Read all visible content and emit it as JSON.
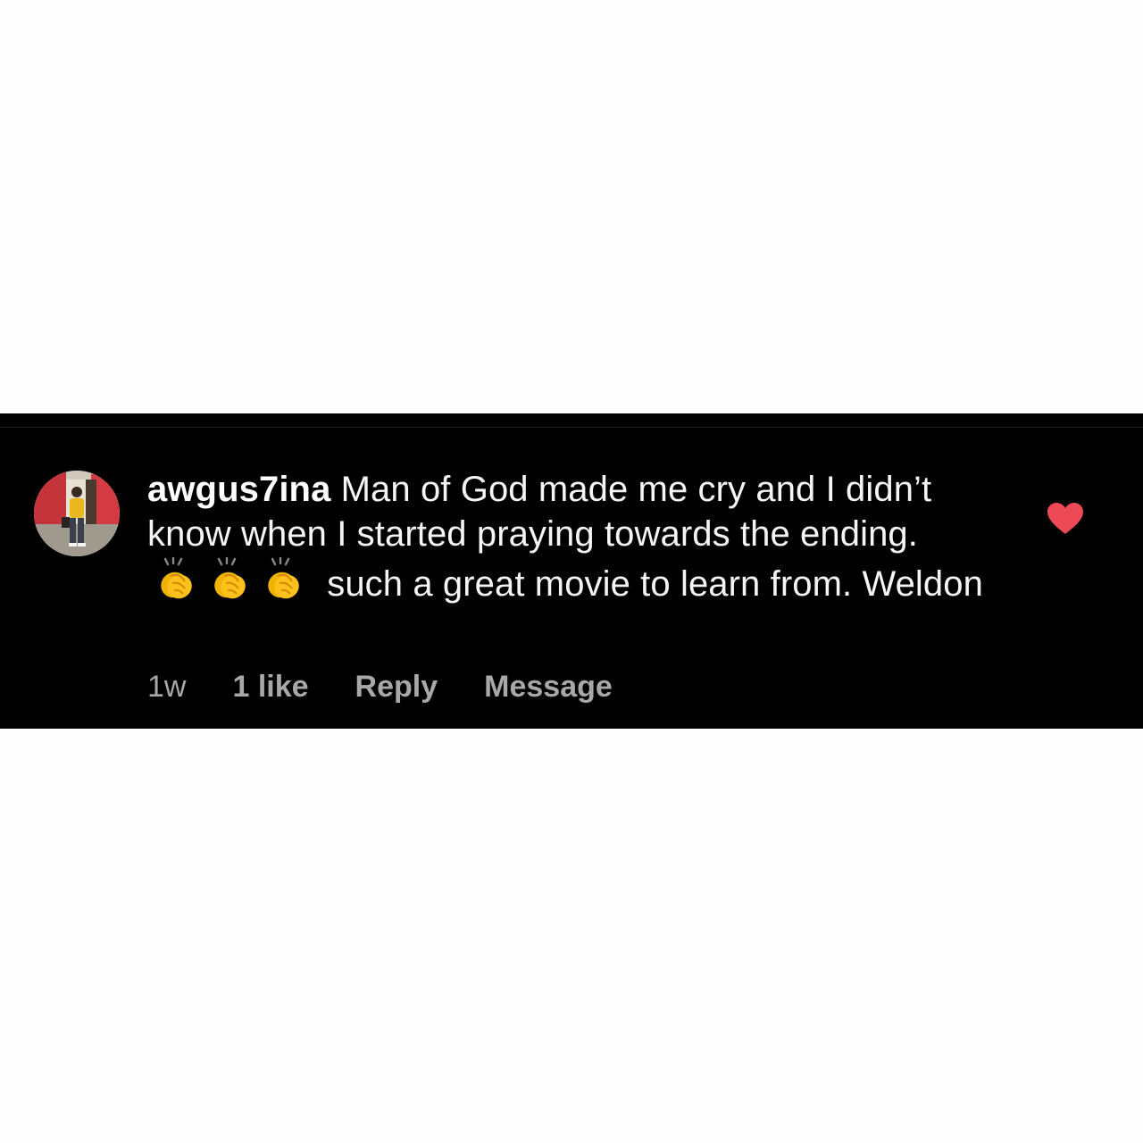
{
  "comment": {
    "username": "awgus7ina",
    "text_line1": "Man of God made me cry and I didn’t know when I started praying towards the ending.",
    "emoji": [
      "👏",
      "👏",
      "👏"
    ],
    "text_line2": "such a great movie to learn from. Weldon",
    "liked": true,
    "like_color": "#ed4956"
  },
  "meta": {
    "time": "1w",
    "likes": "1 like",
    "reply_label": "Reply",
    "message_label": "Message"
  },
  "icons": {
    "avatar": "profile-photo",
    "like": "heart-icon",
    "emoji": "clapping-hands-icon"
  }
}
